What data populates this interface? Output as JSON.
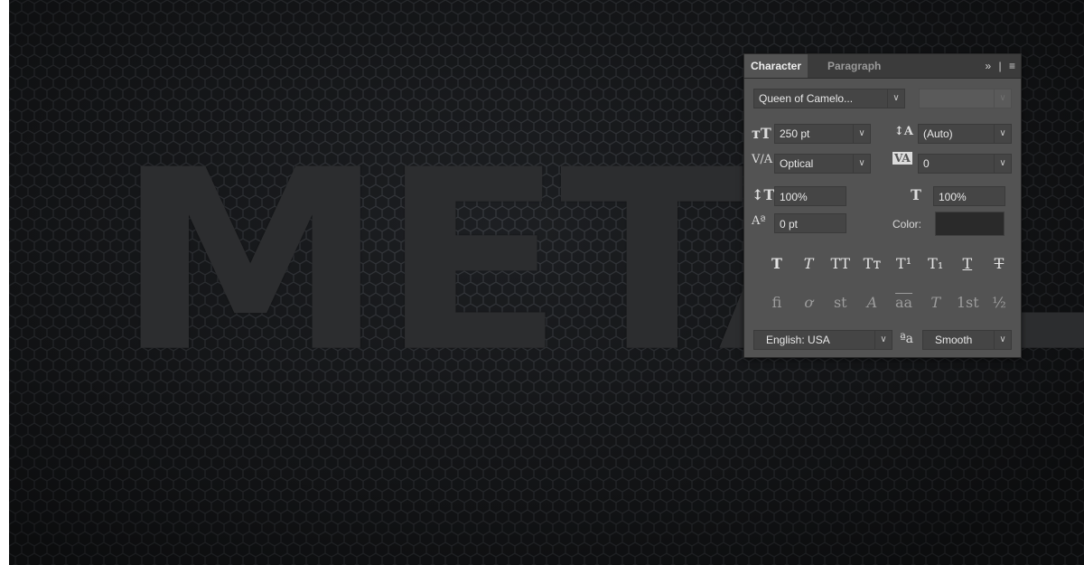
{
  "canvas": {
    "text": "METAL"
  },
  "panel": {
    "tabs": [
      "Character",
      "Paragraph"
    ],
    "tab_tools": {
      "expand": "»",
      "separator": "|",
      "menu": "≡"
    },
    "font_family": "Queen of Camelo...",
    "font_style": "",
    "size": "250 pt",
    "leading": "(Auto)",
    "kerning": "Optical",
    "tracking": "0",
    "vertical_scale": "100%",
    "horizontal_scale": "100%",
    "baseline_shift": "0 pt",
    "color_label": "Color:",
    "color_value": "#2a2a2a",
    "style_buttons": [
      "T",
      "T",
      "TT",
      "Tт",
      "T¹",
      "T₁",
      "T",
      "T"
    ],
    "opentype_buttons": [
      "fi",
      "ơ",
      "st",
      "A",
      "aa",
      "T",
      "1st",
      "½"
    ],
    "language": "English: USA",
    "aa_icon": "ªa",
    "antialias": "Smooth"
  }
}
